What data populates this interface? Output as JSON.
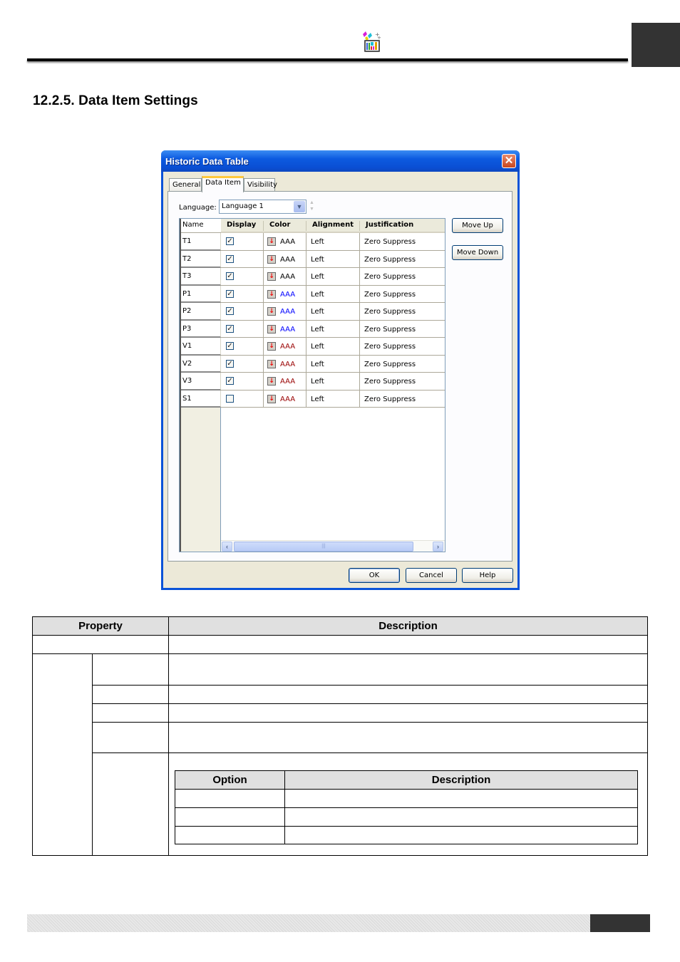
{
  "page": {
    "header_icon": "historic-data-table-icon",
    "section_title": "12.2.5. Data Item Settings"
  },
  "dialog": {
    "title": "Historic Data Table",
    "close_icon": "close-icon",
    "tabs": [
      {
        "label": "General",
        "active": false
      },
      {
        "label": "Data Item",
        "active": true
      },
      {
        "label": "Visibility",
        "active": false
      }
    ],
    "language": {
      "label": "Language:",
      "value": "Language 1"
    },
    "grid": {
      "columns": [
        "Name",
        "Display",
        "Color",
        "Alignment",
        "Justification"
      ],
      "rows": [
        {
          "name": "T1",
          "display": true,
          "color_text": "AAA",
          "color": "#000000",
          "alignment": "Left",
          "justification": "Zero Suppress"
        },
        {
          "name": "T2",
          "display": true,
          "color_text": "AAA",
          "color": "#000000",
          "alignment": "Left",
          "justification": "Zero Suppress"
        },
        {
          "name": "T3",
          "display": true,
          "color_text": "AAA",
          "color": "#000000",
          "alignment": "Left",
          "justification": "Zero Suppress"
        },
        {
          "name": "P1",
          "display": true,
          "color_text": "AAA",
          "color": "#0000ff",
          "alignment": "Left",
          "justification": "Zero Suppress"
        },
        {
          "name": "P2",
          "display": true,
          "color_text": "AAA",
          "color": "#0000ff",
          "alignment": "Left",
          "justification": "Zero Suppress"
        },
        {
          "name": "P3",
          "display": true,
          "color_text": "AAA",
          "color": "#0000ff",
          "alignment": "Left",
          "justification": "Zero Suppress"
        },
        {
          "name": "V1",
          "display": true,
          "color_text": "AAA",
          "color": "#990000",
          "alignment": "Left",
          "justification": "Zero Suppress"
        },
        {
          "name": "V2",
          "display": true,
          "color_text": "AAA",
          "color": "#990000",
          "alignment": "Left",
          "justification": "Zero Suppress"
        },
        {
          "name": "V3",
          "display": true,
          "color_text": "AAA",
          "color": "#990000",
          "alignment": "Left",
          "justification": "Zero Suppress"
        },
        {
          "name": "S1",
          "display": false,
          "color_text": "AAA",
          "color": "#990000",
          "alignment": "Left",
          "justification": "Zero Suppress"
        }
      ]
    },
    "buttons": {
      "move_up": "Move Up",
      "move_down": "Move Down",
      "ok": "OK",
      "cancel": "Cancel",
      "help": "Help"
    }
  },
  "property_table": {
    "headers": {
      "property": "Property",
      "description": "Description"
    },
    "option_table": {
      "headers": {
        "option": "Option",
        "description": "Description"
      }
    }
  }
}
